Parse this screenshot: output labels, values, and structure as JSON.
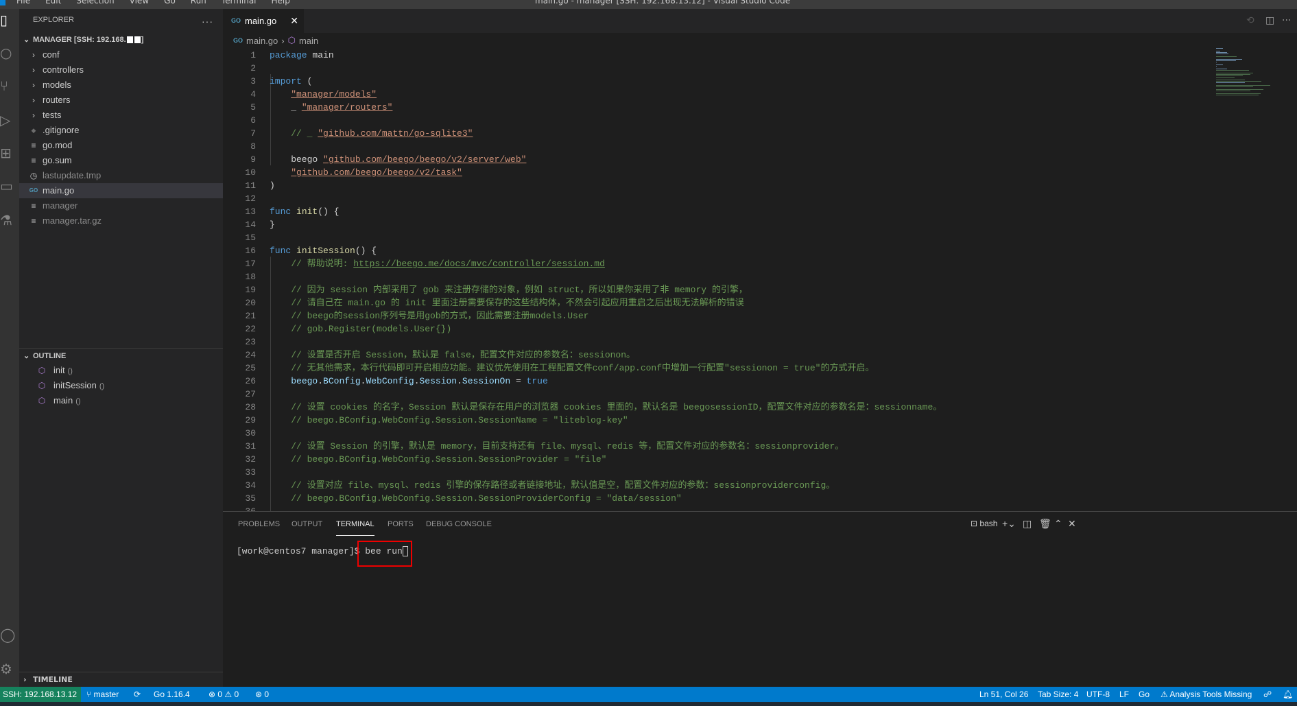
{
  "window": {
    "title": "main.go - manager [SSH: 192.168.13.12] - Visual Studio Code",
    "menu": [
      "File",
      "Edit",
      "Selection",
      "View",
      "Go",
      "Run",
      "Terminal",
      "Help"
    ]
  },
  "sidebar": {
    "title": "EXPLORER",
    "more": "···",
    "root": "MANAGER [SSH: 192.168.",
    "root_end": "]",
    "items": [
      {
        "label": "conf",
        "icon": "chevron-right",
        "type": "folder"
      },
      {
        "label": "controllers",
        "icon": "chevron-right",
        "type": "folder"
      },
      {
        "label": "models",
        "icon": "chevron-right",
        "type": "folder"
      },
      {
        "label": "routers",
        "icon": "chevron-right",
        "type": "folder"
      },
      {
        "label": "tests",
        "icon": "chevron-right",
        "type": "folder"
      },
      {
        "label": ".gitignore",
        "icon": "git-icon",
        "type": "file"
      },
      {
        "label": "go.mod",
        "icon": "lines-icon",
        "type": "file"
      },
      {
        "label": "go.sum",
        "icon": "lines-icon",
        "type": "file"
      },
      {
        "label": "lastupdate.tmp",
        "icon": "clock-icon",
        "type": "file",
        "dim": true
      },
      {
        "label": "main.go",
        "icon": "go-icon",
        "type": "file",
        "selected": true
      },
      {
        "label": "manager",
        "icon": "lines-icon",
        "type": "file",
        "dim": true
      },
      {
        "label": "manager.tar.gz",
        "icon": "lines-icon",
        "type": "file",
        "dim": true
      }
    ],
    "outline": {
      "title": "OUTLINE",
      "items": [
        {
          "label": "init",
          "suffix": "()"
        },
        {
          "label": "initSession",
          "suffix": "()"
        },
        {
          "label": "main",
          "suffix": "()"
        }
      ]
    },
    "timeline": "TIMELINE"
  },
  "tab": {
    "label": "main.go",
    "go": "GO",
    "close": "✕"
  },
  "breadcrumb": {
    "file": "main.go",
    "sep": "›",
    "symbol": "main"
  },
  "editor": {
    "lines": [
      [
        [
          "kw",
          "package"
        ],
        [
          "pl",
          " main"
        ]
      ],
      [],
      [
        [
          "kw",
          "import"
        ],
        [
          "pl",
          " ("
        ]
      ],
      [
        [
          "pl",
          "    "
        ],
        [
          "str",
          "\"manager/models\""
        ]
      ],
      [
        [
          "pl",
          "    _ "
        ],
        [
          "str",
          "\"manager/routers\""
        ]
      ],
      [],
      [
        [
          "cm",
          "    // _ "
        ],
        [
          "str",
          "\"github.com/mattn/go-sqlite3\""
        ]
      ],
      [],
      [
        [
          "pl",
          "    beego "
        ],
        [
          "str",
          "\"github.com/beego/beego/v2/server/web\""
        ]
      ],
      [
        [
          "pl",
          "    "
        ],
        [
          "str",
          "\"github.com/beego/beego/v2/task\""
        ]
      ],
      [
        [
          "pl",
          ")"
        ]
      ],
      [],
      [
        [
          "kw",
          "func"
        ],
        [
          "pl",
          " "
        ],
        [
          "fn",
          "init"
        ],
        [
          "pl",
          "() {"
        ]
      ],
      [
        [
          "pl",
          "}"
        ]
      ],
      [],
      [
        [
          "kw",
          "func"
        ],
        [
          "pl",
          " "
        ],
        [
          "fn",
          "initSession"
        ],
        [
          "pl",
          "() {"
        ]
      ],
      [
        [
          "cm",
          "    // 帮助说明: "
        ],
        [
          "url",
          "https://beego.me/docs/mvc/controller/session.md"
        ]
      ],
      [],
      [
        [
          "cm",
          "    // 因为 session 内部采用了 gob 来注册存储的对象，例如 struct，所以如果你采用了非 memory 的引擎，"
        ]
      ],
      [
        [
          "cm",
          "    // 请自己在 main.go 的 init 里面注册需要保存的这些结构体，不然会引起应用重启之后出现无法解析的错误"
        ]
      ],
      [
        [
          "cm",
          "    // beego的session序列号是用gob的方式，因此需要注册models.User"
        ]
      ],
      [
        [
          "cm",
          "    // gob.Register(models.User{})"
        ]
      ],
      [],
      [
        [
          "cm",
          "    // 设置是否开启 Session，默认是 false，配置文件对应的参数名：sessionon。"
        ]
      ],
      [
        [
          "cm",
          "    // 无其他需求，本行代码即可开启相应功能。建议优先使用在工程配置文件conf/app.conf中增加一行配置\"sessionon = true\"的方式开启。"
        ]
      ],
      [
        [
          "pl",
          "    "
        ],
        [
          "var",
          "beego"
        ],
        [
          "pl",
          "."
        ],
        [
          "var",
          "BConfig"
        ],
        [
          "pl",
          "."
        ],
        [
          "var",
          "WebConfig"
        ],
        [
          "pl",
          "."
        ],
        [
          "var",
          "Session"
        ],
        [
          "pl",
          "."
        ],
        [
          "var",
          "SessionOn"
        ],
        [
          "pl",
          " = "
        ],
        [
          "kw",
          "true"
        ]
      ],
      [],
      [
        [
          "cm",
          "    // 设置 cookies 的名字，Session 默认是保存在用户的浏览器 cookies 里面的，默认名是 beegosessionID，配置文件对应的参数名是：sessionname。"
        ]
      ],
      [
        [
          "cm",
          "    // beego.BConfig.WebConfig.Session.SessionName = \"liteblog-key\""
        ]
      ],
      [],
      [
        [
          "cm",
          "    // 设置 Session 的引擎，默认是 memory，目前支持还有 file、mysql、redis 等，配置文件对应的参数名：sessionprovider。"
        ]
      ],
      [
        [
          "cm",
          "    // beego.BConfig.WebConfig.Session.SessionProvider = \"file\""
        ]
      ],
      [],
      [
        [
          "cm",
          "    // 设置对应 file、mysql、redis 引擎的保存路径或者链接地址，默认值是空，配置文件对应的参数：sessionproviderconfig。"
        ]
      ],
      [
        [
          "cm",
          "    // beego.BConfig.WebConfig.Session.SessionProviderConfig = \"data/session\""
        ]
      ],
      []
    ]
  },
  "panel": {
    "tabs": [
      "PROBLEMS",
      "OUTPUT",
      "TERMINAL",
      "PORTS",
      "DEBUG CONSOLE"
    ],
    "active": "TERMINAL",
    "shell": "bash",
    "prompt": "[work@centos7 manager]$ ",
    "command": "bee run"
  },
  "status": {
    "remote": "SSH: 192.168.13.12",
    "branch": "master",
    "sync": "⟳",
    "go": "Go 1.16.4",
    "problems": "⊗ 0 ⚠ 0",
    "ports": "0",
    "position": "Ln 51, Col 26",
    "tab_size": "Tab Size: 4",
    "encoding": "UTF-8",
    "eol": "LF",
    "language": "Go",
    "analysis": "⚠ Analysis Tools Missing"
  },
  "colors": {
    "accent": "#007acc",
    "remote": "#16825d",
    "highlight": "#ee0000"
  }
}
